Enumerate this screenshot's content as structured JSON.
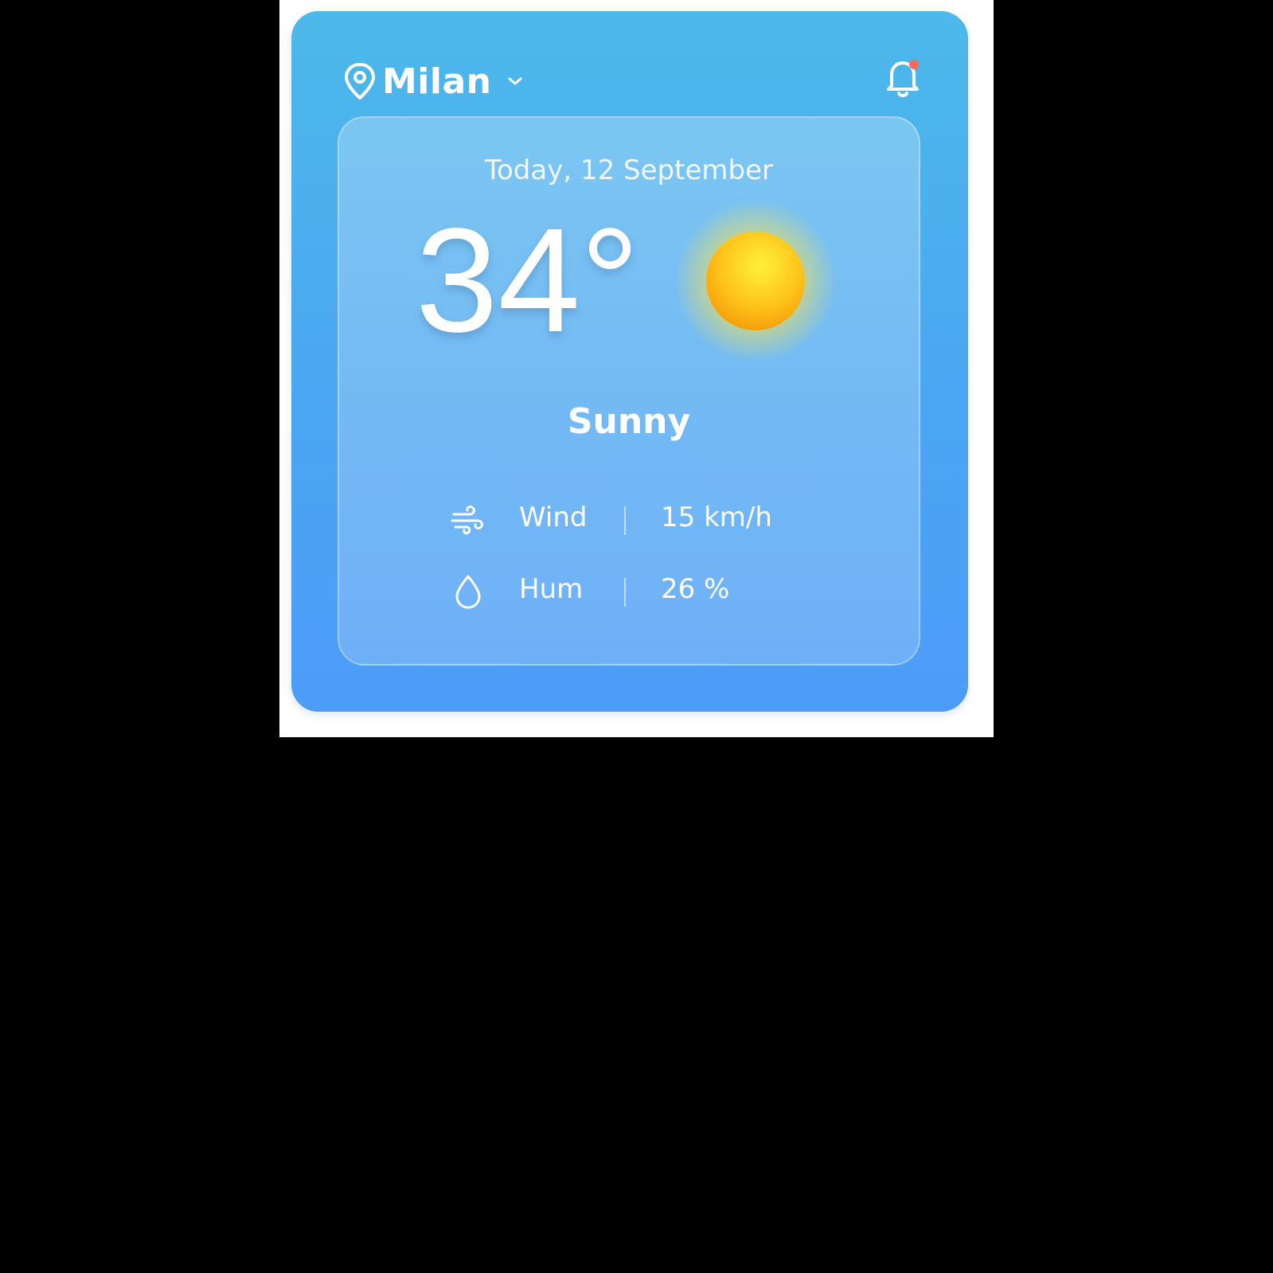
{
  "header": {
    "city": "Milan"
  },
  "card": {
    "date": "Today, 12 September",
    "temperature": "34°",
    "condition": "Sunny",
    "metrics": [
      {
        "label": "Wind",
        "value": "15 km/h",
        "icon": "wind-icon"
      },
      {
        "label": "Hum",
        "value": "26 %",
        "icon": "droplet-icon"
      }
    ]
  },
  "icons": {
    "location": "map-pin-icon",
    "dropdown": "chevron-down-icon",
    "notifications": "bell-icon",
    "weather": "sun-icon"
  },
  "colors": {
    "widget_top": "#4db9ea",
    "widget_bottom": "#4d9cf8",
    "sun": "#ffc21a",
    "notification_dot": "#ff6b5a",
    "text": "#ffffff"
  }
}
